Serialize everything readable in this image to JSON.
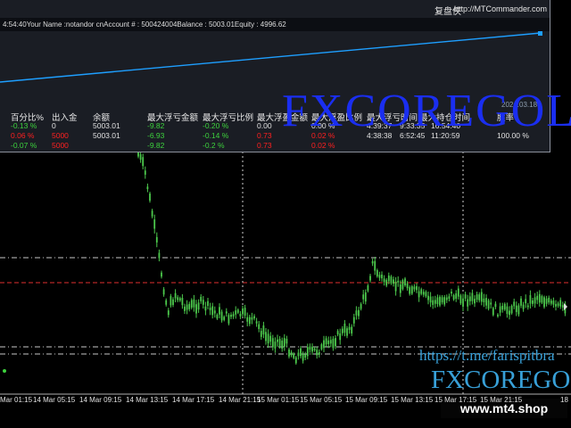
{
  "panel": {
    "brand": "复盘侠",
    "url": "http://MTCommander.com",
    "account_line": "4:54:40Your Name   :notandor cnAccount #  : 500424004Balance : 5003.01Equity   : 4996.62",
    "date_fragment": "2024.03.18",
    "headers": [
      "百分比%",
      "出入金",
      "余额",
      "最大浮亏金额",
      "最大浮亏比例",
      "最大浮盈金额",
      "最大浮盈比例",
      "最大浮亏时间",
      "最大持仓时间",
      "胜率"
    ],
    "rows": [
      [
        "-0.13 %",
        "0",
        "5003.01",
        "-9.82",
        "-0.20 %",
        "0.00",
        "0.00 %",
        "4:39:37",
        "9:33:35",
        "16:54:40",
        ""
      ],
      [
        "0.06 %",
        "5000",
        "5003.01",
        "-6.93",
        "-0.14 %",
        "0.73",
        "0.02 %",
        "4:38:38",
        "6:52:45",
        "11:20:59",
        "100.00 %"
      ],
      [
        "-0.07 %",
        "5000",
        "",
        "-9.82",
        "-0.2 %",
        "0.73",
        "0.02 %",
        "",
        "",
        "",
        ""
      ]
    ],
    "colors": {
      "equity_line": "#1e9fff",
      "gain": "#3dd23d",
      "loss": "#ff2020"
    }
  },
  "chart": {
    "x_labels": [
      "Mar 01:15",
      "14 Mar 05:15",
      "14 Mar 09:15",
      "14 Mar 13:15",
      "14 Mar 17:15",
      "14 Mar 21:15",
      "15 Mar 01:15",
      "15 Mar 05:15",
      "15 Mar 09:15",
      "15 Mar 13:15",
      "15 Mar 17:15",
      "15 Mar 21:15",
      "18"
    ],
    "candle_color": "#4cc94c",
    "dashed_line_colors": [
      "#c8c8c8",
      "#e03030"
    ]
  },
  "brand_overlay": "FXCOREGOLD",
  "watermark": {
    "telegram": "https://t.me/farispitbra",
    "fx": "FXCOREGO"
  },
  "badge": "www.mt4.shop"
}
